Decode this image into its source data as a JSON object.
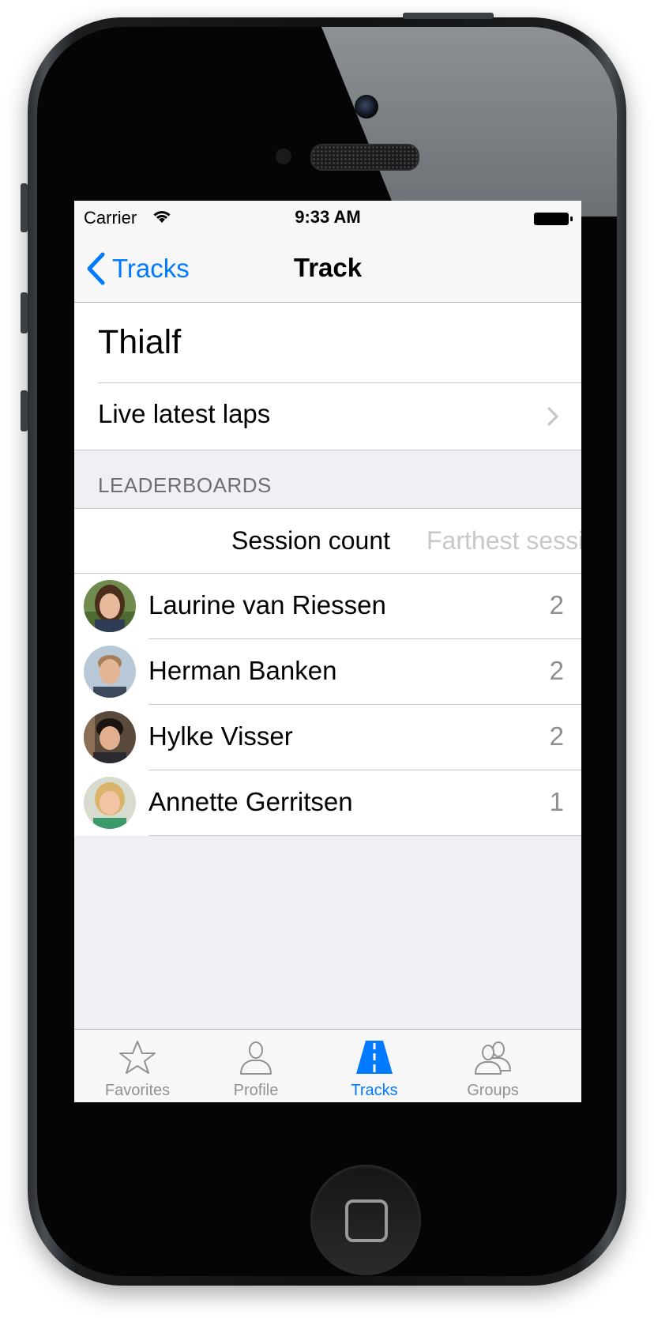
{
  "status_bar": {
    "carrier": "Carrier",
    "time": "9:33 AM"
  },
  "nav": {
    "back_label": "Tracks",
    "title": "Track"
  },
  "track": {
    "name": "Thialf",
    "live_label": "Live latest laps"
  },
  "leaderboards": {
    "header": "LEADERBOARDS",
    "segments": [
      "Session count",
      "Farthest session"
    ],
    "active_segment": "Session count",
    "rows": [
      {
        "name": "Laurine van Riessen",
        "count": "2"
      },
      {
        "name": "Herman Banken",
        "count": "2"
      },
      {
        "name": "Hylke Visser",
        "count": "2"
      },
      {
        "name": "Annette Gerritsen",
        "count": "1"
      }
    ]
  },
  "tabbar": {
    "items": [
      {
        "label": "Favorites",
        "icon": "star-icon"
      },
      {
        "label": "Profile",
        "icon": "person-icon"
      },
      {
        "label": "Tracks",
        "icon": "road-icon"
      },
      {
        "label": "Groups",
        "icon": "group-icon"
      }
    ],
    "active": "Tracks"
  },
  "colors": {
    "accent": "#007aff",
    "separator": "#c8c7cc",
    "background": "#efeff4"
  }
}
